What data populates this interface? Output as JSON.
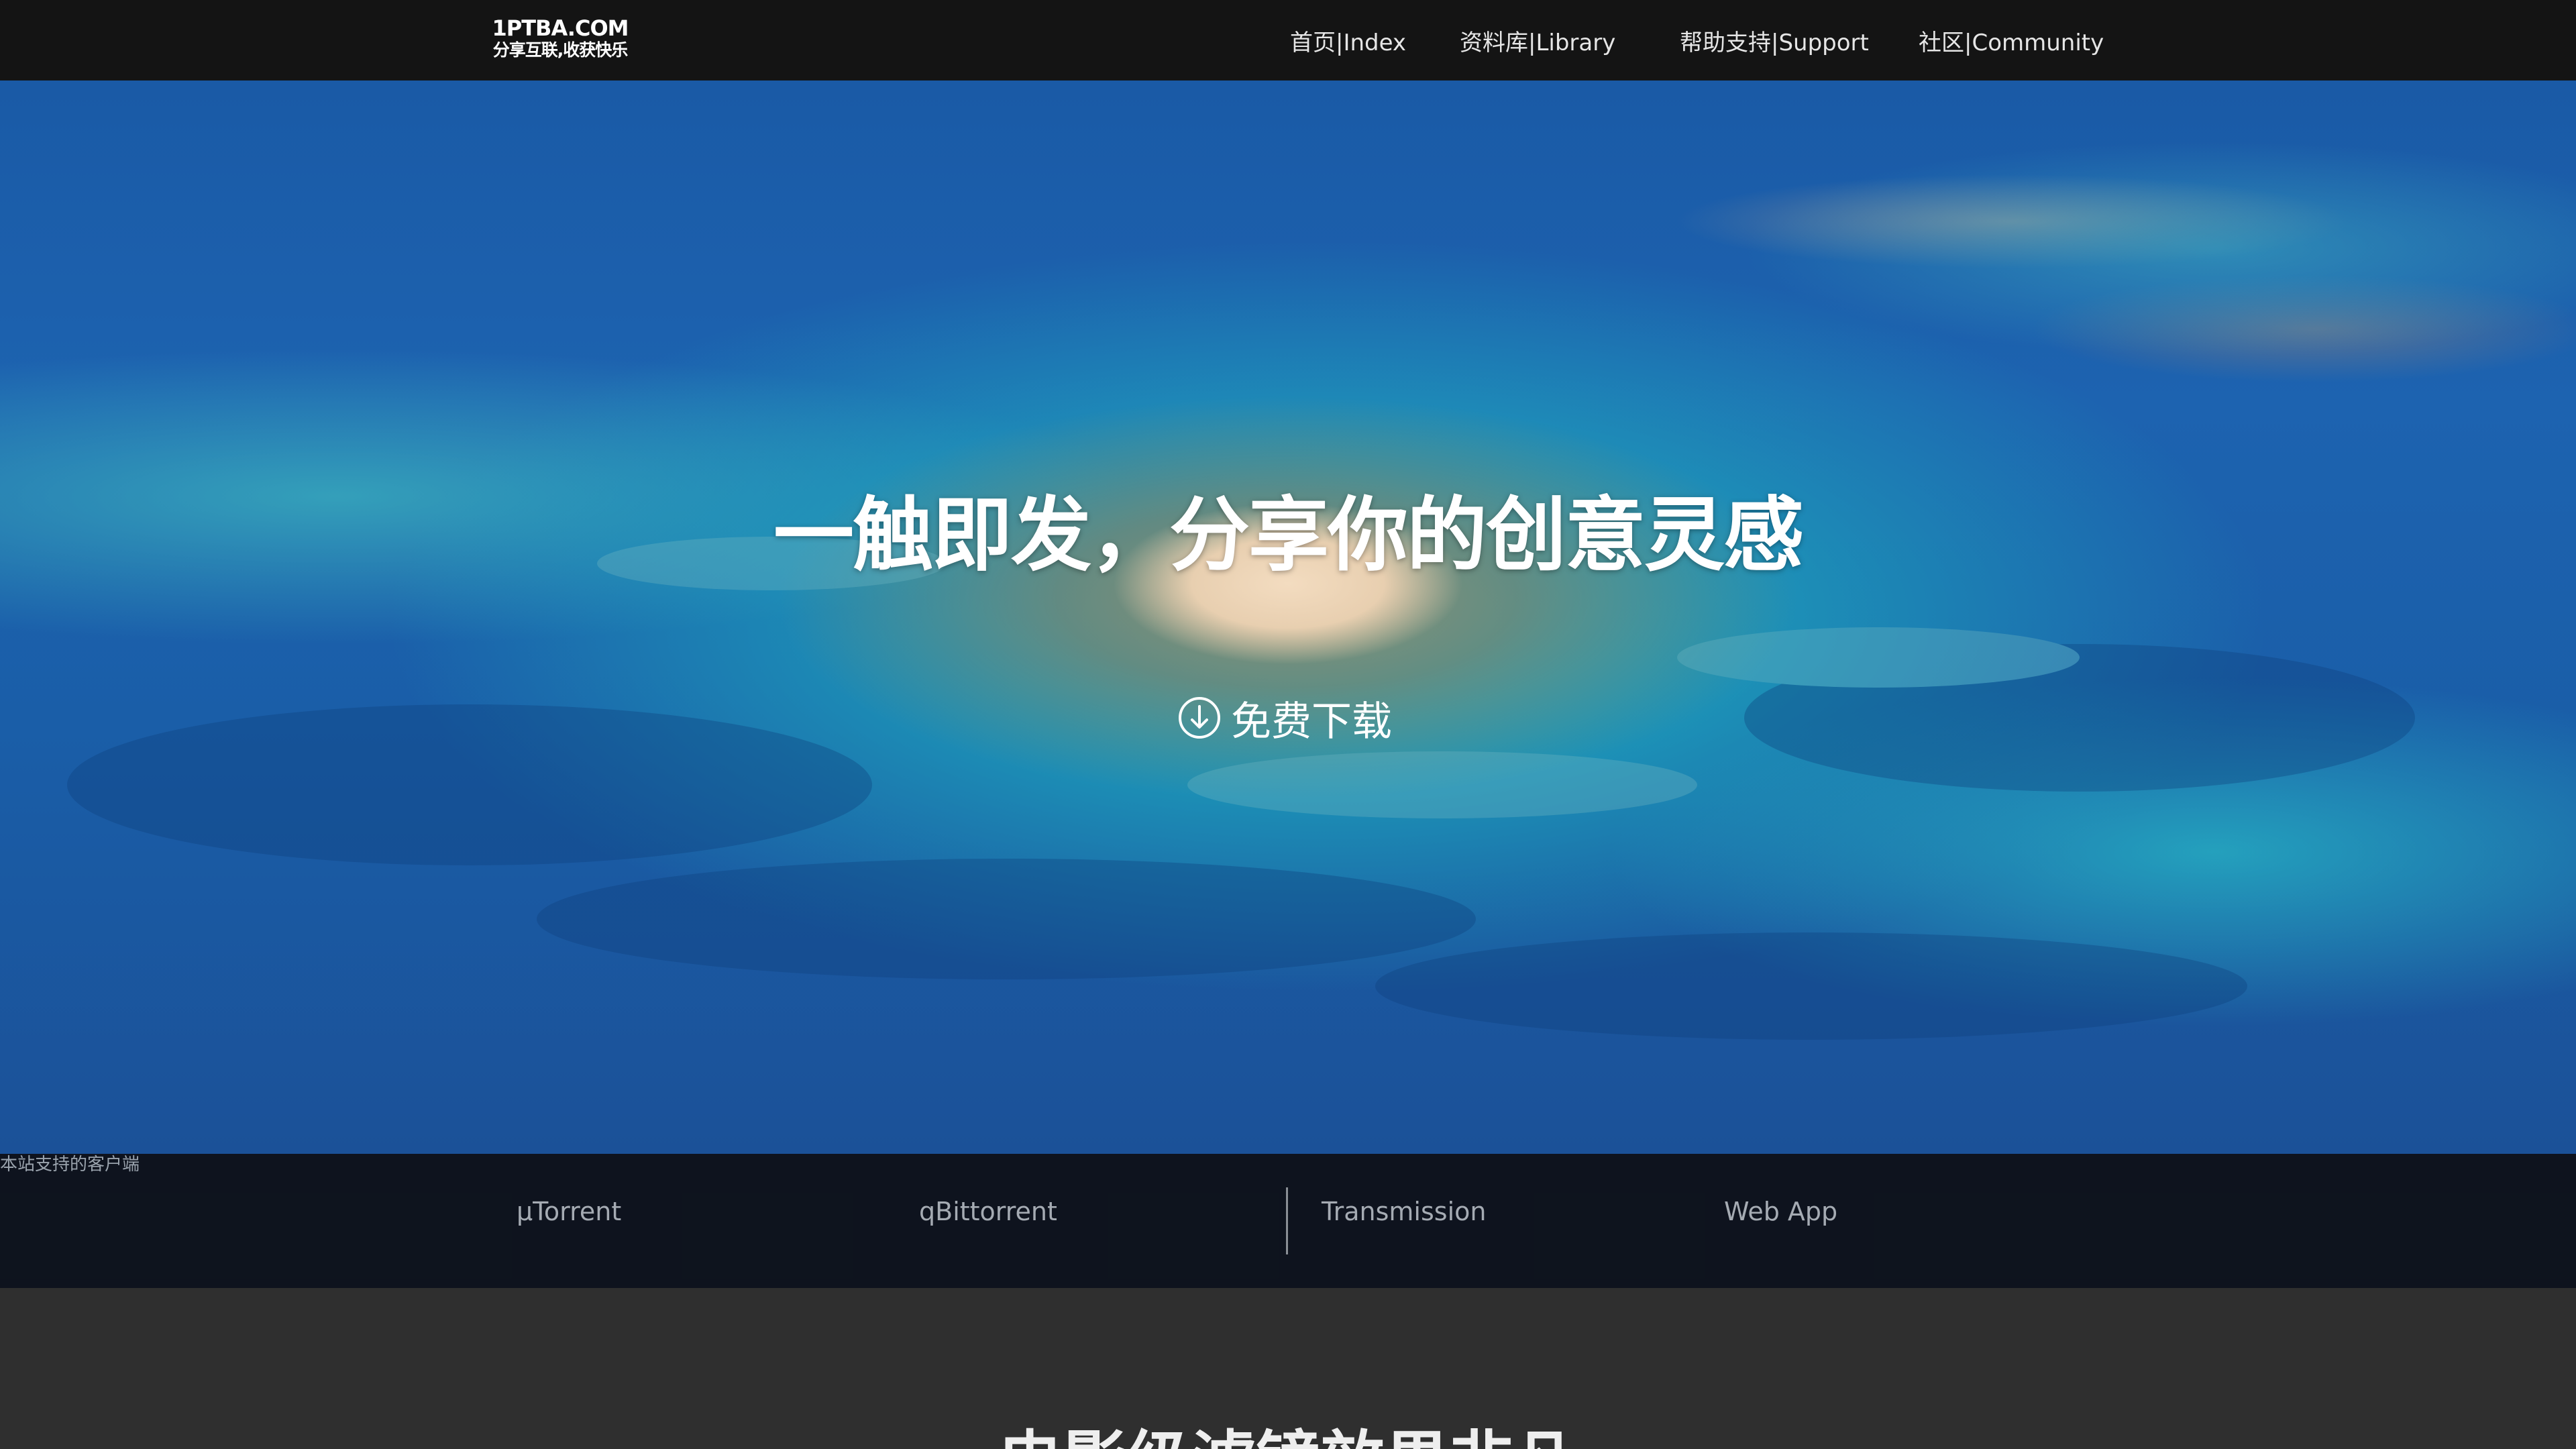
{
  "header": {
    "logo": {
      "line1": "1PTBA.COM",
      "line2": "分享互联,收获快乐"
    },
    "nav": [
      {
        "label": "首页|Index"
      },
      {
        "label": "资料库|Library"
      },
      {
        "label": "帮助支持|Support"
      },
      {
        "label": "社区|Community"
      }
    ]
  },
  "hero": {
    "title": "一触即发，分享你的创意灵感",
    "download_label": "免费下载",
    "download_icon": "download-circle-icon"
  },
  "clients": {
    "caption": "本站支持的客户端",
    "items": [
      {
        "label": "µTorrent"
      },
      {
        "label": "qBittorrent"
      },
      {
        "label": "Transmission"
      },
      {
        "label": "Web App"
      }
    ]
  },
  "section": {
    "title": "电影级滤镜效果非凡"
  },
  "colors": {
    "topbar": "#141414",
    "ocean": "#1a5ea8",
    "lagoon": "#28c8c8",
    "clients_bar": "#0a101c",
    "section": "#2f2f2f"
  }
}
